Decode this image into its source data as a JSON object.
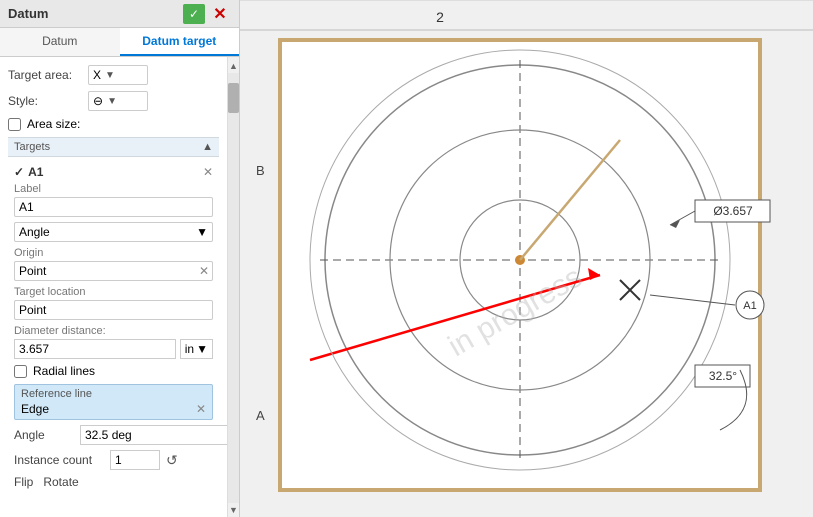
{
  "panel": {
    "title": "Datum",
    "check_btn": "✓",
    "close_btn": "✕",
    "tabs": [
      {
        "id": "datum",
        "label": "Datum",
        "active": false
      },
      {
        "id": "datum-target",
        "label": "Datum target",
        "active": true
      }
    ],
    "target_area_label": "Target area:",
    "target_area_value": "X",
    "style_label": "Style:",
    "style_value": "⊖",
    "area_size_label": "Area size:",
    "targets_section": "Targets",
    "target_a1": {
      "name": "A1",
      "label_field_label": "Label",
      "label_field_value": "A1",
      "angle_dropdown_label": "Angle",
      "origin_label": "Origin",
      "origin_value": "Point",
      "target_location_label": "Target location",
      "target_location_value": "Point",
      "diameter_label": "Diameter distance:",
      "diameter_value": "3.657 in",
      "diameter_unit": "in",
      "radial_lines_label": "Radial lines",
      "reference_line_label": "Reference line",
      "reference_line_value": "Edge",
      "angle_label": "Angle",
      "angle_value": "32.5 deg",
      "instance_label": "Instance count",
      "instance_value": "1",
      "flip_label": "Flip",
      "rotate_label": "Rotate"
    }
  },
  "drawing": {
    "col2_label": "2",
    "row_b_label": "B",
    "row_a_label": "A",
    "diameter_annotation": "Ø3.657",
    "angle_annotation": "32.5°",
    "target_label": "A1",
    "watermark": "in progress"
  },
  "icons": {
    "check": "✓",
    "close": "✕",
    "dropdown": "▼",
    "expand": "✓",
    "remove": "✕",
    "refresh": "↺",
    "expand_arrow": "▾"
  }
}
